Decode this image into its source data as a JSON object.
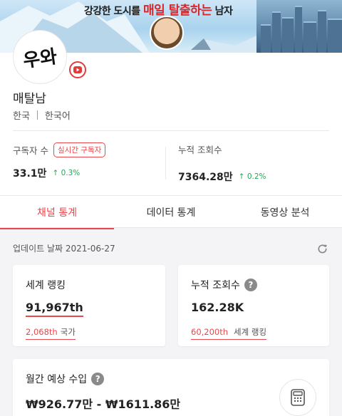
{
  "banner": {
    "tagline_prefix": "강강한 도시를",
    "tagline_highlight": "매일 탈출하는",
    "tagline_suffix": "남자"
  },
  "channel": {
    "avatar_text": "우와",
    "name": "매탈남",
    "country": "한국",
    "language": "한국어"
  },
  "stats": {
    "subscribers": {
      "label": "구독자 수",
      "live_badge": "실시간 구독자",
      "value": "33.1만",
      "change": "0.3%"
    },
    "views": {
      "label": "누적 조회수",
      "value": "7364.28만",
      "change": "0.2%"
    }
  },
  "tabs": [
    {
      "label": "채널 통계",
      "active": true
    },
    {
      "label": "데이터 통계",
      "active": false
    },
    {
      "label": "동영상 분석",
      "active": false
    }
  ],
  "updated": "업데이트 날짜 2021-06-27",
  "cards": {
    "world_rank": {
      "title": "세계 랭킹",
      "value": "91,967th",
      "sub_rank": "2,068th",
      "sub_label": "국가"
    },
    "total_views": {
      "title": "누적 조회수",
      "help": "?",
      "value": "162.28K",
      "sub_rank": "60,200th",
      "sub_label": "세계 랭킹"
    },
    "monthly_income": {
      "title": "월간 예상 수입",
      "help": "?",
      "value": "₩926.77만 - ₩1611.86만"
    }
  },
  "colors": {
    "accent": "#e5484d",
    "positive": "#26a65b"
  },
  "icons": {
    "youtube": "youtube-icon",
    "refresh": "refresh-icon",
    "help": "question-icon",
    "calculator": "calculator-icon",
    "up_arrow": "arrow-up-icon"
  }
}
